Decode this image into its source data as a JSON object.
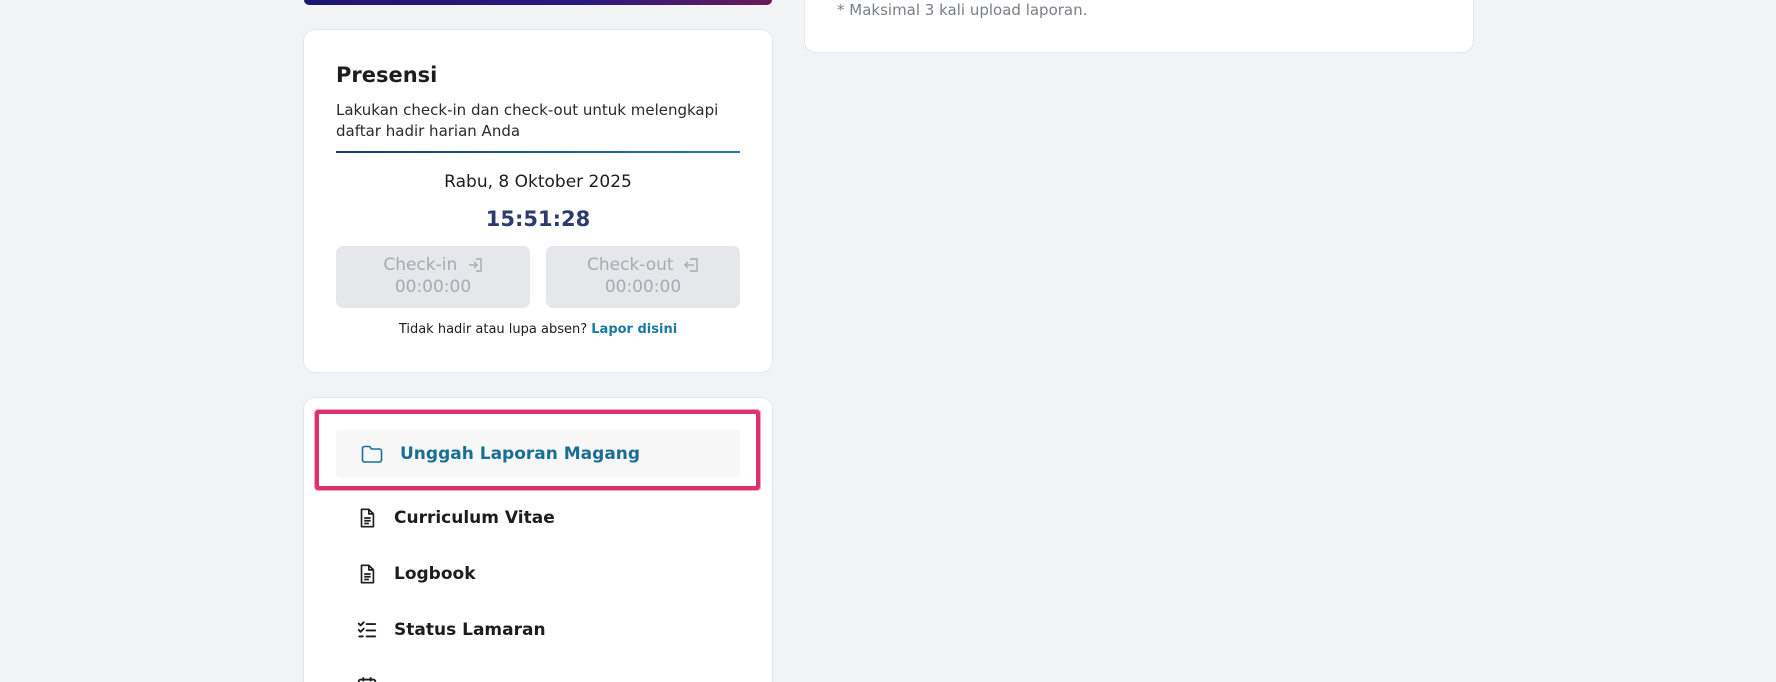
{
  "upload_panel": {
    "note": "* Maksimal 3 kali upload laporan."
  },
  "presensi": {
    "title": "Presensi",
    "description": "Lakukan check-in dan check-out untuk melengkapi daftar hadir harian Anda",
    "date": "Rabu, 8 Oktober 2025",
    "time": "15:51:28",
    "checkin": {
      "label": "Check-in",
      "time": "00:00:00",
      "icon": "login-icon"
    },
    "checkout": {
      "label": "Check-out",
      "time": "00:00:00",
      "icon": "logout-icon"
    },
    "footer_text": "Tidak hadir atau lupa absen?",
    "footer_link": "Lapor disini"
  },
  "menu": {
    "items": [
      {
        "label": "Unggah Laporan Magang",
        "icon": "folder-icon",
        "active": true
      },
      {
        "label": "Curriculum Vitae",
        "icon": "document-icon"
      },
      {
        "label": "Logbook",
        "icon": "document-icon"
      },
      {
        "label": "Status Lamaran",
        "icon": "checklist-icon"
      }
    ]
  },
  "colors": {
    "accent": "#1b6f95",
    "time_text": "#2b3a6f",
    "highlight": "#e0306a",
    "background": "#f2f3f5"
  }
}
